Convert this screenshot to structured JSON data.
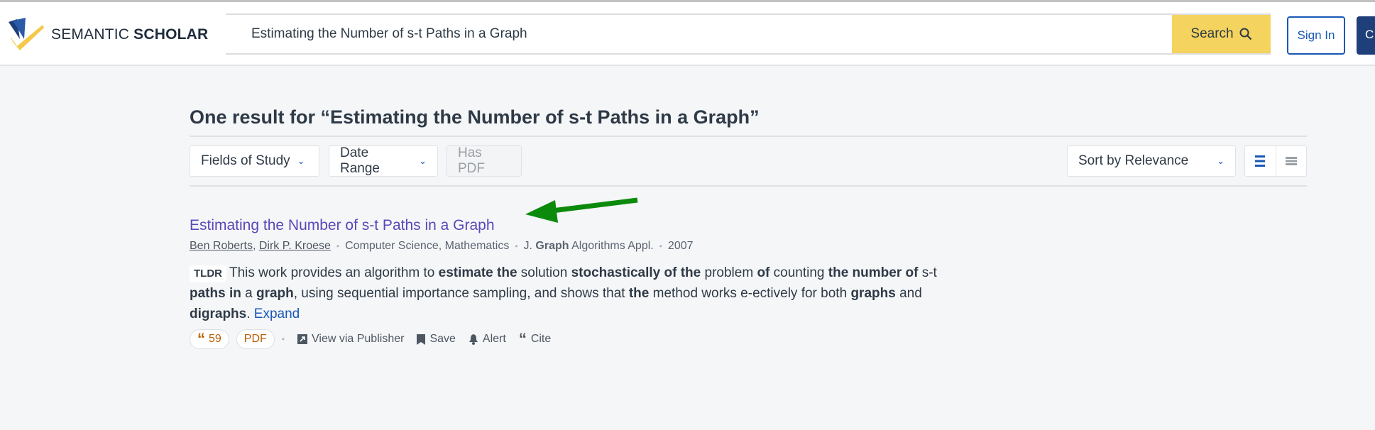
{
  "header": {
    "logo": "SEMANTIC SCHOLAR",
    "logo_a": "SEMANTIC",
    "logo_b": "SCHOLAR",
    "search_value": "Estimating the Number of s-t Paths in a Graph",
    "search_button": "Search",
    "sign_in": "Sign In",
    "create": "C"
  },
  "results": {
    "heading": "One result for “Estimating the Number of s-t Paths in a Graph”"
  },
  "filters": {
    "fields": "Fields of Study",
    "date": "Date Range",
    "pdf": "Has PDF",
    "sort": "Sort by Relevance"
  },
  "paper": {
    "title": "Estimating the Number of s-t Paths in a Graph",
    "authors": [
      "Ben Roberts",
      "Dirk P. Kroese"
    ],
    "fields": "Computer Science, Mathematics",
    "venue_a": "J.",
    "venue_b": "Graph",
    "venue_c": "Algorithms Appl.",
    "year": "2007",
    "tldr_label": "TLDR",
    "tldr_segments": [
      {
        "t": "This work provides an algorithm to ",
        "b": false
      },
      {
        "t": "estimate",
        "b": true
      },
      {
        "t": " ",
        "b": false
      },
      {
        "t": "the",
        "b": true
      },
      {
        "t": " solution ",
        "b": false
      },
      {
        "t": "stochastically",
        "b": true
      },
      {
        "t": " ",
        "b": false
      },
      {
        "t": "of the",
        "b": true
      },
      {
        "t": " problem ",
        "b": false
      },
      {
        "t": "of",
        "b": true
      },
      {
        "t": " counting ",
        "b": false
      },
      {
        "t": "the number of",
        "b": true
      },
      {
        "t": " s-t ",
        "b": false
      },
      {
        "t": "paths in",
        "b": true
      },
      {
        "t": " a ",
        "b": false
      },
      {
        "t": "graph",
        "b": true
      },
      {
        "t": ", using sequential importance sampling, and shows that ",
        "b": false
      },
      {
        "t": "the",
        "b": true
      },
      {
        "t": " method works e-ectively for both ",
        "b": false
      },
      {
        "t": "graphs",
        "b": true
      },
      {
        "t": " and ",
        "b": false
      },
      {
        "t": "digraphs",
        "b": true
      },
      {
        "t": ". ",
        "b": false
      }
    ],
    "expand": "Expand",
    "citations": "59",
    "pdf": "PDF",
    "view": "View via Publisher",
    "save": "Save",
    "alert": "Alert",
    "cite": "Cite"
  },
  "colors": {
    "accent": "#1857b6",
    "search_button": "#f4d35e",
    "title": "#5a47b8",
    "arrow": "#0b8a0b"
  }
}
